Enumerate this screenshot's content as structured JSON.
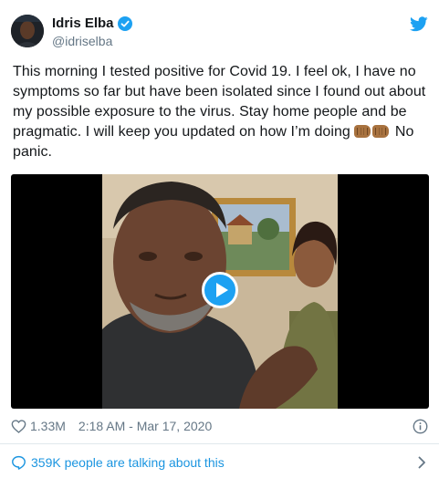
{
  "user": {
    "display_name": "Idris Elba",
    "handle": "@idriselba",
    "verified": true
  },
  "tweet": {
    "text_main": "This morning I tested positive for Covid 19. I feel ok, I have no symptoms so far but have been isolated since I found out about my possible exposure to the virus.  Stay home people and be pragmatic. I will keep you updated on how I’m doing",
    "emoji": [
      "fist-bump",
      "fist-bump"
    ],
    "text_end": " No panic."
  },
  "meta": {
    "likes": "1.33M",
    "timestamp": "2:18 AM - Mar 17, 2020"
  },
  "conversation": {
    "label": "359K people are talking about this"
  },
  "colors": {
    "brand": "#1da1f2",
    "link": "#1b95e0",
    "muted": "#657786"
  },
  "icons": {
    "logo": "twitter-bird-icon",
    "verified": "verified-badge-icon",
    "play": "play-icon",
    "like": "heart-icon",
    "info": "info-icon",
    "conversation": "speech-bubble-icon",
    "more": "chevron-right-icon"
  }
}
